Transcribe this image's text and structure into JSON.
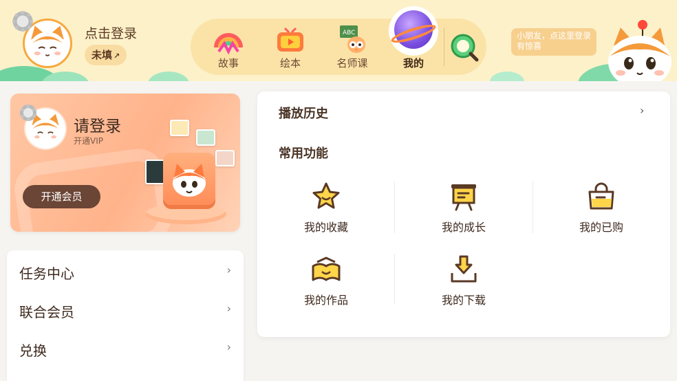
{
  "header": {
    "login_title": "点击登录",
    "unfilled": "未填",
    "edit_glyph": "↗",
    "nav": [
      {
        "label": "故事",
        "icon": "story-rainbow-icon"
      },
      {
        "label": "绘本",
        "icon": "picture-book-tv-icon"
      },
      {
        "label": "名师课",
        "icon": "teacher-class-icon"
      },
      {
        "label": "我的",
        "icon": "my-planet-icon",
        "active": true
      }
    ],
    "search_icon": "search-icon",
    "bubble": "小朋友，点这里登录有惊喜"
  },
  "vip_card": {
    "title": "请登录",
    "subtitle": "开通VIP",
    "button": "开通会员"
  },
  "left_list": [
    {
      "label": "任务中心"
    },
    {
      "label": "联合会员"
    },
    {
      "label": "兑换"
    }
  ],
  "right_panel": {
    "history": "播放历史",
    "common_title": "常用功能",
    "functions": [
      {
        "label": "我的收藏",
        "icon": "star-favorite-icon"
      },
      {
        "label": "我的成长",
        "icon": "growth-board-icon"
      },
      {
        "label": "我的已购",
        "icon": "shopping-bag-icon"
      },
      {
        "label": "我的作品",
        "icon": "open-book-works-icon"
      },
      {
        "label": "我的下载",
        "icon": "download-icon"
      }
    ]
  },
  "colors": {
    "accent_orange": "#f7a83f",
    "icon_yellow": "#ffd54a",
    "icon_brown": "#5a3a24",
    "vip_button": "#6b4535"
  }
}
